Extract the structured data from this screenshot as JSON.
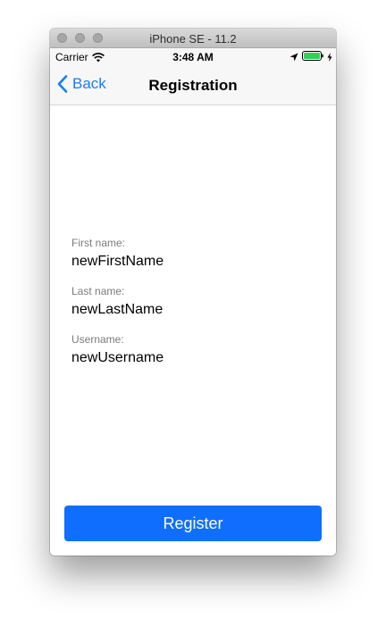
{
  "window": {
    "title": "iPhone SE - 11.2"
  },
  "statusbar": {
    "carrier": "Carrier",
    "time": "3:48 AM",
    "icons": [
      "wifi-icon",
      "location-icon",
      "battery-icon",
      "charge-icon"
    ]
  },
  "navbar": {
    "back_label": "Back",
    "title": "Registration"
  },
  "form": {
    "fields": [
      {
        "label": "First name:",
        "value": "newFirstName"
      },
      {
        "label": "Last name:",
        "value": "newLastName"
      },
      {
        "label": "Username:",
        "value": "newUsername"
      }
    ]
  },
  "register_button": {
    "label": "Register"
  },
  "colors": {
    "accent": "#147efb",
    "button_bg": "#0f6efd",
    "battery": "#2fd158"
  }
}
